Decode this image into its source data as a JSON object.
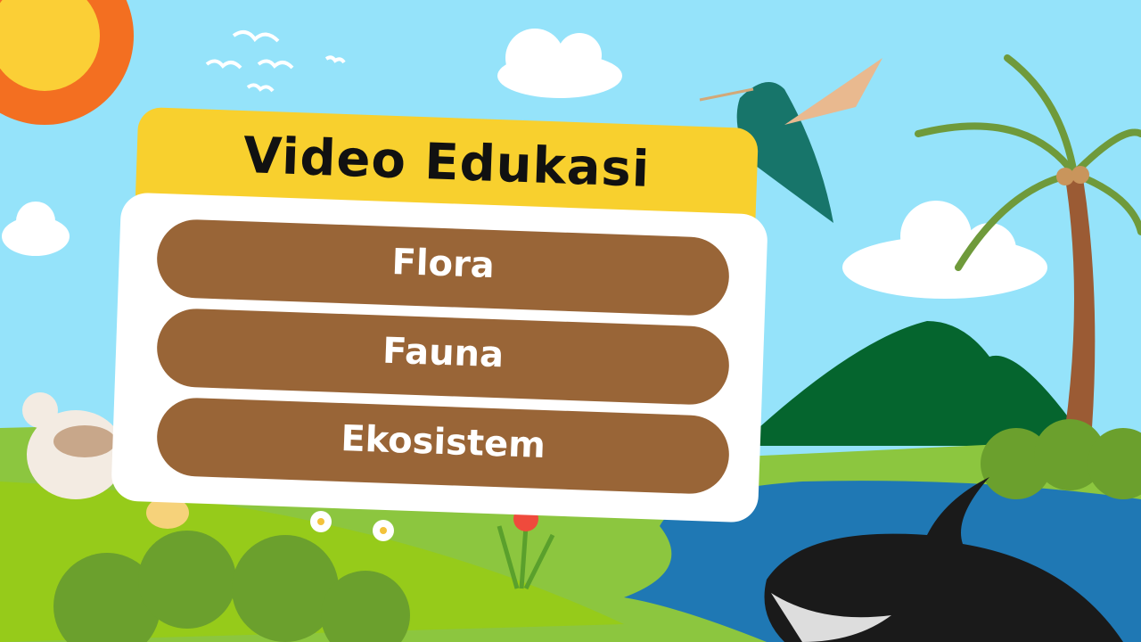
{
  "title": "Video Edukasi",
  "menu": [
    {
      "label": "Flora"
    },
    {
      "label": "Fauna"
    },
    {
      "label": "Ekosistem"
    }
  ],
  "colors": {
    "sky": "#95e3fa",
    "banner": "#f8d02e",
    "button": "#996537",
    "grass": "#8cc63f",
    "water": "#1f78b4"
  },
  "icons": [
    "sun-icon",
    "cloud-icon",
    "bird-icon",
    "hummingbird-icon",
    "palm-tree-icon",
    "mountain-icon",
    "orca-icon",
    "hen-icon",
    "chick-icon",
    "flower-icon",
    "bush-icon"
  ]
}
